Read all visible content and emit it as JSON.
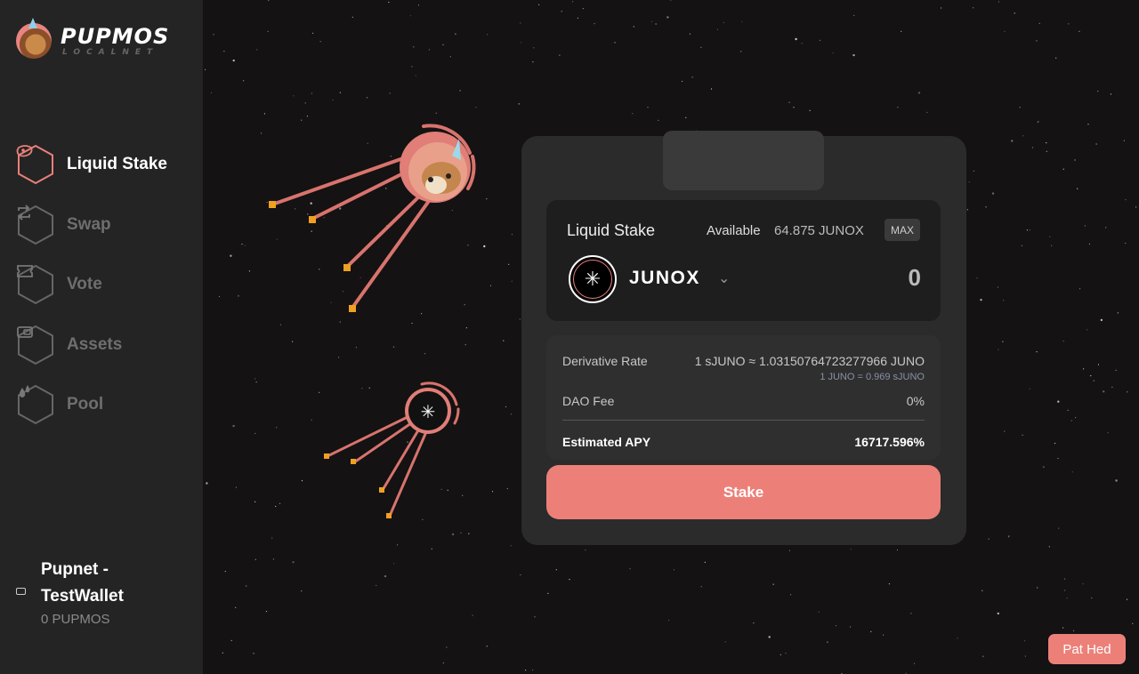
{
  "brand": {
    "title": "PUPMOS",
    "subtitle": "LOCALNET",
    "logo_icon": "unicorn-dog-avatar"
  },
  "sidebar": {
    "items": [
      {
        "label": "Liquid Stake",
        "icon": "steak-icon",
        "active": true
      },
      {
        "label": "Swap",
        "icon": "swap-icon",
        "active": false
      },
      {
        "label": "Vote",
        "icon": "ticket-icon",
        "active": false
      },
      {
        "label": "Assets",
        "icon": "wallet-icon",
        "active": false
      },
      {
        "label": "Pool",
        "icon": "drops-icon",
        "active": false
      }
    ]
  },
  "wallet": {
    "name": "Pupnet - TestWallet",
    "balance": "0 PUPMOS",
    "icon": "wallet-icon"
  },
  "stake_card": {
    "title": "Liquid Stake",
    "available_label": "Available",
    "available_value": "64.875 JUNOX",
    "max_label": "MAX",
    "token": "JUNOX",
    "token_icon": "juno-star-icon",
    "amount_placeholder": "0",
    "derivative_rate_label": "Derivative Rate",
    "derivative_rate_value": "1 sJUNO ≈ 1.03150764723277966 JUNO",
    "derivative_rate_inverse": "1 JUNO = 0.969 sJUNO",
    "dao_fee_label": "DAO Fee",
    "dao_fee_value": "0%",
    "apy_label": "Estimated APY",
    "apy_value": "16717.596%",
    "stake_button": "Stake"
  },
  "footer": {
    "pat_button": "Pat Hed"
  },
  "colors": {
    "accent": "#ec8079",
    "sidebar_bg": "#242424",
    "card_bg": "#2b2b2b",
    "space_bg": "#141213"
  }
}
